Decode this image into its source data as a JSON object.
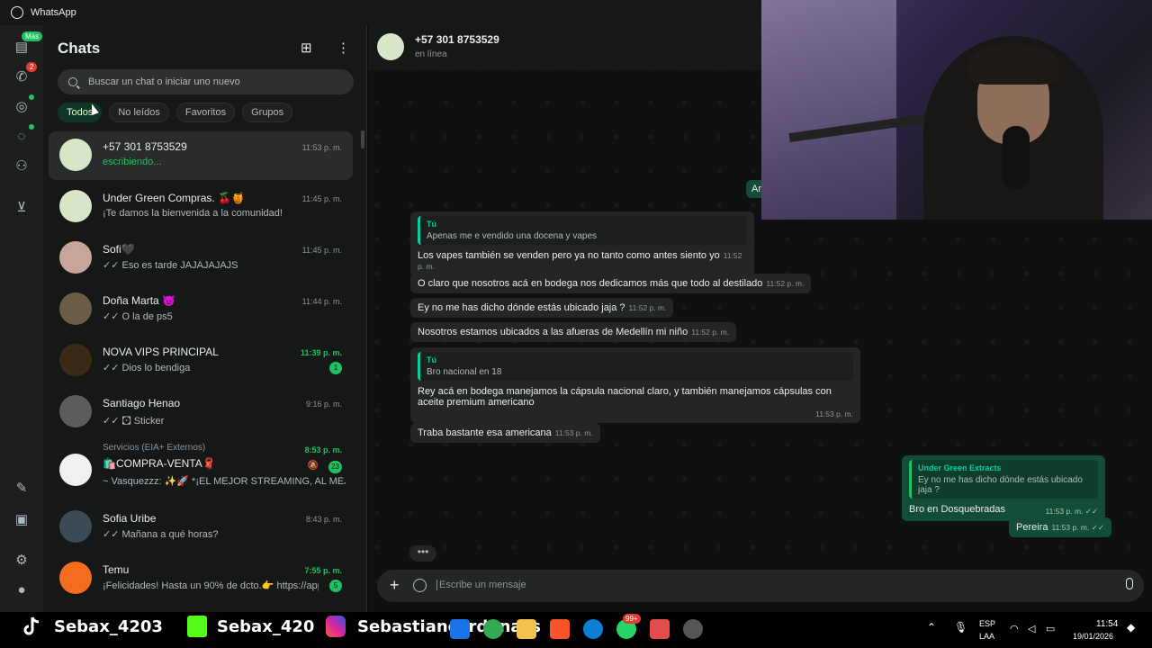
{
  "app": {
    "title": "WhatsApp"
  },
  "rail": {
    "chats_badge": "Más",
    "calls_badge": "2"
  },
  "chatlist": {
    "title": "Chats",
    "search_placeholder": "Buscar un chat o iniciar uno nuevo",
    "filters": [
      "Todos",
      "No leídos",
      "Favoritos",
      "Grupos"
    ],
    "items": [
      {
        "name": "+57 301 8753529",
        "time": "11:53 p. m.",
        "msg": "escribiendo...",
        "avatar": "#d7e6c9"
      },
      {
        "name": "Under Green Compras. 🍒🍯",
        "time": "11:45 p. m.",
        "msg": "¡Te damos la bienvenida a la comunidad!",
        "avatar": "#d7e6c9"
      },
      {
        "name": "Sofi🖤",
        "time": "11:45 p. m.",
        "msg": "✓✓ Eso es tarde JAJAJAJAJS",
        "avatar": "#c9a49a"
      },
      {
        "name": "Doña Marta 👿",
        "time": "11:44 p. m.",
        "msg": "✓✓ O la de ps5",
        "avatar": "#6b5c47"
      },
      {
        "name": "NOVA VIPS PRINCIPAL",
        "time": "11:39 p. m.",
        "msg": "✓✓ Dios lo bendiga",
        "badge": "1",
        "avatar": "#3a2a18"
      },
      {
        "name": "Santiago Henao",
        "time": "9:16 p. m.",
        "msg": "✓✓ 🖸 Sticker",
        "avatar": "#5c5c5c"
      },
      {
        "group": "Servicios (EIA+ Externos)",
        "name": "🛍️COMPRA-VENTA🧣",
        "time": "8:53 p. m.",
        "msg": "~ Vasquezzz: ✨🚀 *¡EL MEJOR STREAMING, AL MEJ...",
        "badge": "23",
        "avatar": "#f0f0f0"
      },
      {
        "name": "Sofia Uribe",
        "time": "8:43 p. m.",
        "msg": "✓✓ Mañana a qué horas?",
        "avatar": "#3b4a54"
      },
      {
        "name": "Temu",
        "time": "7:55 p. m.",
        "msg": "¡Felicidades! Hasta un 90% de dcto.👉 https://app....",
        "badge": "5",
        "avatar": "#f36c1f"
      }
    ]
  },
  "conversation": {
    "contact": "+57 301 8753529",
    "status": "en línea",
    "partial_bubble": "Ar",
    "messages": [
      {
        "quote_name": "Tú",
        "quote_text": "Apenas me e vendido una docena y vapes",
        "text": "Los vapes también se venden pero ya no tanto como antes siento yo",
        "time": "11:52 p. m."
      },
      {
        "text": "O claro que nosotros acá en bodega nos dedicamos más que todo al destilado",
        "time": "11:52 p. m."
      },
      {
        "text": "Ey no me has dicho dónde estás ubicado jaja ?",
        "time": "11:52 p. m."
      },
      {
        "text": "Nosotros estamos ubicados a las afueras de Medellín mi niño",
        "time": "11:52 p. m."
      },
      {
        "quote_name": "Tú",
        "quote_text": "Bro nacional en 18",
        "text": "Rey acá en bodega manejamos la cápsula nacional claro, y también manejamos cápsulas con aceite premium americano",
        "time": "11:53 p. m."
      },
      {
        "text": "Traba bastante esa americana",
        "time": "11:53 p. m."
      }
    ],
    "outgoing": [
      {
        "quote_name": "Under Green Extracts",
        "quote_text": "Ey no me has dicho dónde estás ubicado jaja ?",
        "text": "Bro en Dosquebradas",
        "time": "11:53 p. m. ✓✓"
      },
      {
        "text": "Pereira",
        "time": "11:53 p. m. ✓✓"
      }
    ],
    "composer_placeholder": "Escribe un mensaje"
  },
  "taskbar": {
    "tiktok": "Sebax_4203",
    "kick": "Sebax_420",
    "instagram": "Sebastiancardonass",
    "whatsapp_badge": "99+",
    "lang": "ESP",
    "layout": "LAA",
    "time": "11:54",
    "date": "19/01/2026"
  }
}
